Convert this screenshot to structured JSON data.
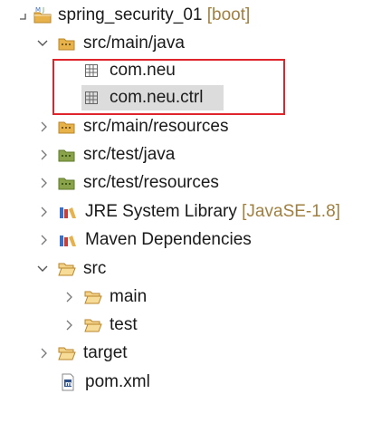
{
  "colors": {
    "selection": "#dcdcdc",
    "highlight_box": "#e0242c",
    "decoration_text": "#a08040",
    "folder": "#e8b24a",
    "package_folder": "#c9a24a",
    "test_folder": "#8aa34a"
  },
  "tree": {
    "project": {
      "label": "spring_security_01",
      "decoration": "[boot]",
      "icon": "project-icon"
    },
    "src_main_java": {
      "label": "src/main/java",
      "icon": "source-folder-icon",
      "packages": [
        {
          "label": "com.neu",
          "icon": "package-icon"
        },
        {
          "label": "com.neu.ctrl",
          "icon": "package-icon"
        }
      ]
    },
    "src_main_resources": {
      "label": "src/main/resources",
      "icon": "source-folder-icon"
    },
    "src_test_java": {
      "label": "src/test/java",
      "icon": "test-source-folder-icon"
    },
    "src_test_resources": {
      "label": "src/test/resources",
      "icon": "test-source-folder-icon"
    },
    "jre": {
      "label": "JRE System Library",
      "decoration": "[JavaSE-1.8]",
      "icon": "library-icon"
    },
    "maven": {
      "label": "Maven Dependencies",
      "icon": "library-icon"
    },
    "src": {
      "label": "src",
      "icon": "folder-icon",
      "children": [
        {
          "label": "main",
          "icon": "folder-icon"
        },
        {
          "label": "test",
          "icon": "folder-icon"
        }
      ]
    },
    "target": {
      "label": "target",
      "icon": "folder-icon"
    },
    "pom": {
      "label": "pom.xml",
      "icon": "maven-file-icon"
    }
  }
}
